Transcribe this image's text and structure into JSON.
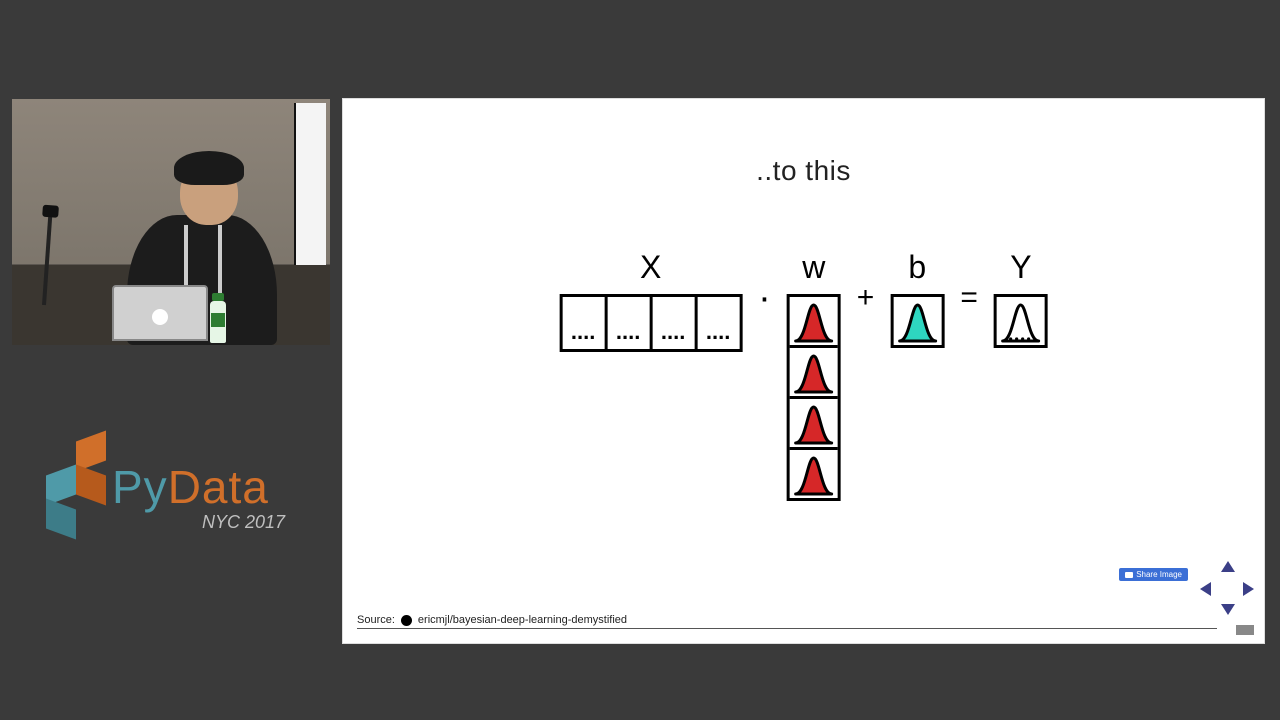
{
  "conference": {
    "brand_py": "Py",
    "brand_data": "Data",
    "edition": "NYC 2017"
  },
  "slide": {
    "title": "..to this",
    "terms": {
      "X": {
        "label": "X",
        "cells": [
          "....",
          "....",
          "....",
          "...."
        ]
      },
      "w": {
        "label": "w",
        "dist_color": "#d62728",
        "count": 4
      },
      "b": {
        "label": "b",
        "dist_color": "#2ed6c0"
      },
      "Y": {
        "label": "Y",
        "dist_color": "#000000",
        "with_dots": true
      }
    },
    "operators": {
      "dot": "·",
      "plus": "+",
      "eq": "="
    },
    "source_prefix": "Source:",
    "source_repo": "ericmjl/bayesian-deep-learning-demystified",
    "share_label": "Share Image"
  }
}
